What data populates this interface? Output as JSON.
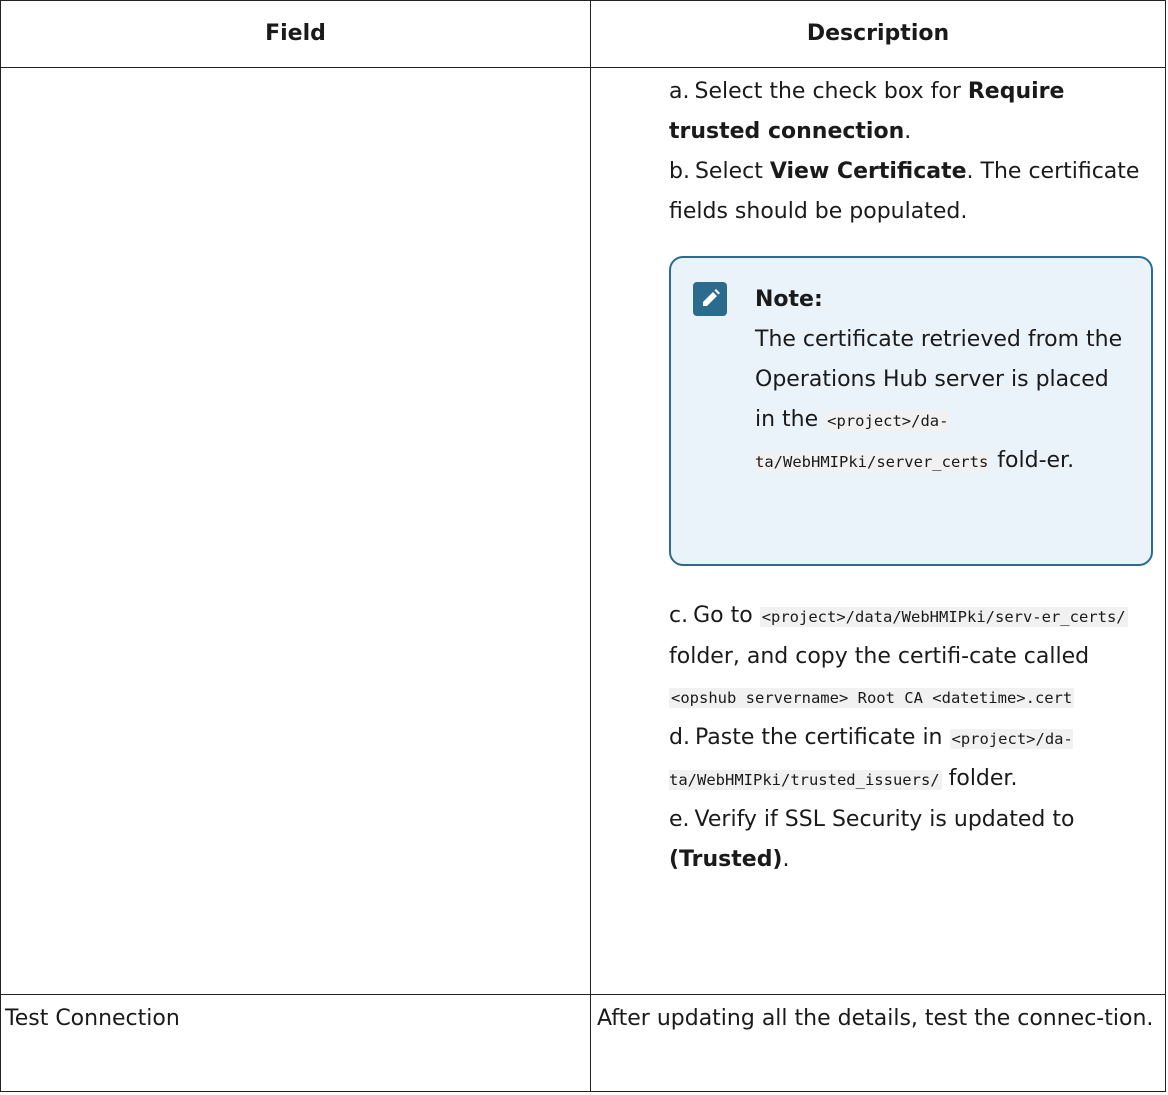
{
  "table": {
    "headers": {
      "field": "Field",
      "description": "Description"
    },
    "row_steps": {
      "field": "",
      "steps": [
        {
          "marker": "a.",
          "pre": "Select the check box for ",
          "bold": "Require trusted connection",
          "post": "."
        },
        {
          "marker": "b.",
          "pre": "Select ",
          "bold": "View Certificate",
          "post": ". The certificate fields should be populated."
        },
        {
          "marker": "c.",
          "pre": "Go to ",
          "code1": "<project>/data/WebHMIPki/serv-er_certs/",
          "mid": " folder, and copy the certifi-cate called ",
          "code2": "<opshub servername> Root CA <datetime>.cert"
        },
        {
          "marker": "d.",
          "pre": "Paste the certificate in ",
          "code1": "<project>/da-ta/WebHMIPki/trusted_issuers/",
          "post": " folder."
        },
        {
          "marker": "e.",
          "pre": "Verify if SSL Security is updated to ",
          "bold": "(Trusted)",
          "post": "."
        }
      ],
      "note": {
        "icon": "pencil-note-icon",
        "title": "Note:",
        "text_pre": "The certificate retrieved from the Operations Hub server is placed in the ",
        "code": "<project>/da-ta/WebHMIPki/server_certs",
        "text_post": " fold-er."
      }
    },
    "row_test": {
      "field": "Test Connection",
      "description": "After updating all the details, test the connec-tion."
    }
  },
  "colors": {
    "note_border": "#2b6c8e",
    "note_background": "#e9f3f9",
    "table_border": "#222222"
  }
}
